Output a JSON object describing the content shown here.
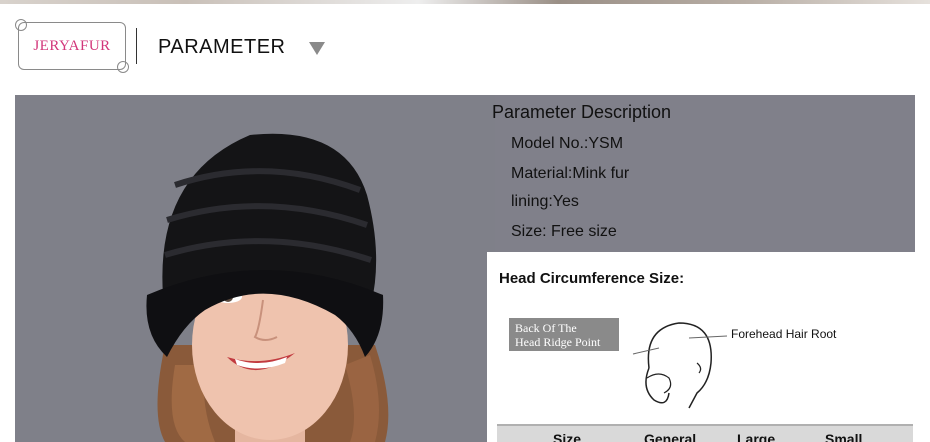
{
  "header": {
    "logo_text": "JERYAFUR",
    "section_title": "PARAMETER"
  },
  "parameters": {
    "title": "Parameter Description",
    "lines": [
      "Model No.:YSM",
      "Material:Mink fur",
      "lining:Yes",
      "Size: Free size"
    ]
  },
  "size_card": {
    "title": "Head Circumference Size:",
    "back_label": [
      "Back Of The",
      "Head Ridge Point"
    ],
    "forehead_label": "Forehead Hair Root",
    "table_headers": [
      "Size",
      "General",
      "Large",
      "Small"
    ]
  },
  "colors": {
    "panel_bg": "#80808a",
    "logo_pink": "#d2367a",
    "hat_black": "#141416"
  },
  "icons": {
    "dropdown": "triangle-down-icon",
    "photo": "model-wearing-fur-hat"
  }
}
